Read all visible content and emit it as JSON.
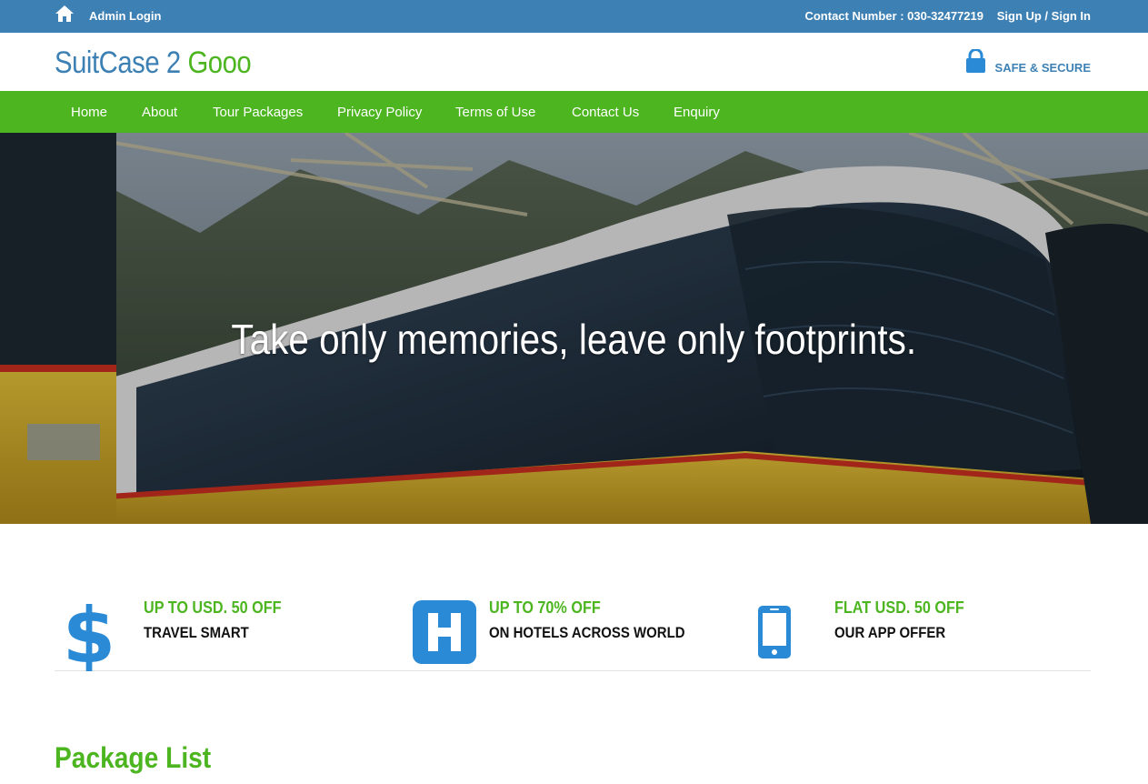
{
  "topbar": {
    "admin_login": "Admin Login",
    "contact": "Contact Number : 030-32477219",
    "signup": "Sign Up / Sign In",
    "home_icon": "home-icon"
  },
  "header": {
    "logo_part1": "SuitCase 2",
    "logo_part2": "Gooo",
    "secure_label": "SAFE & SECURE",
    "lock_icon": "lock-icon"
  },
  "nav": {
    "items": [
      "Home",
      "About",
      "Tour Packages",
      "Privacy Policy",
      "Terms of Use",
      "Contact Us",
      "Enquiry"
    ]
  },
  "hero": {
    "tagline": "Take only memories, leave only footprints."
  },
  "offers": [
    {
      "icon": "dollar-icon",
      "title": "UP TO USD. 50 OFF",
      "subtitle": "TRAVEL SMART"
    },
    {
      "icon": "hotel-icon",
      "title": "UP TO 70% OFF",
      "subtitle": "ON HOTELS ACROSS WORLD"
    },
    {
      "icon": "mobile-icon",
      "title": "FLAT USD. 50 OFF",
      "subtitle": "OUR APP OFFER"
    }
  ],
  "packages": {
    "title": "Package List"
  },
  "colors": {
    "blue": "#3d80b4",
    "green": "#4cb520",
    "icon_blue": "#2a8ad6"
  }
}
